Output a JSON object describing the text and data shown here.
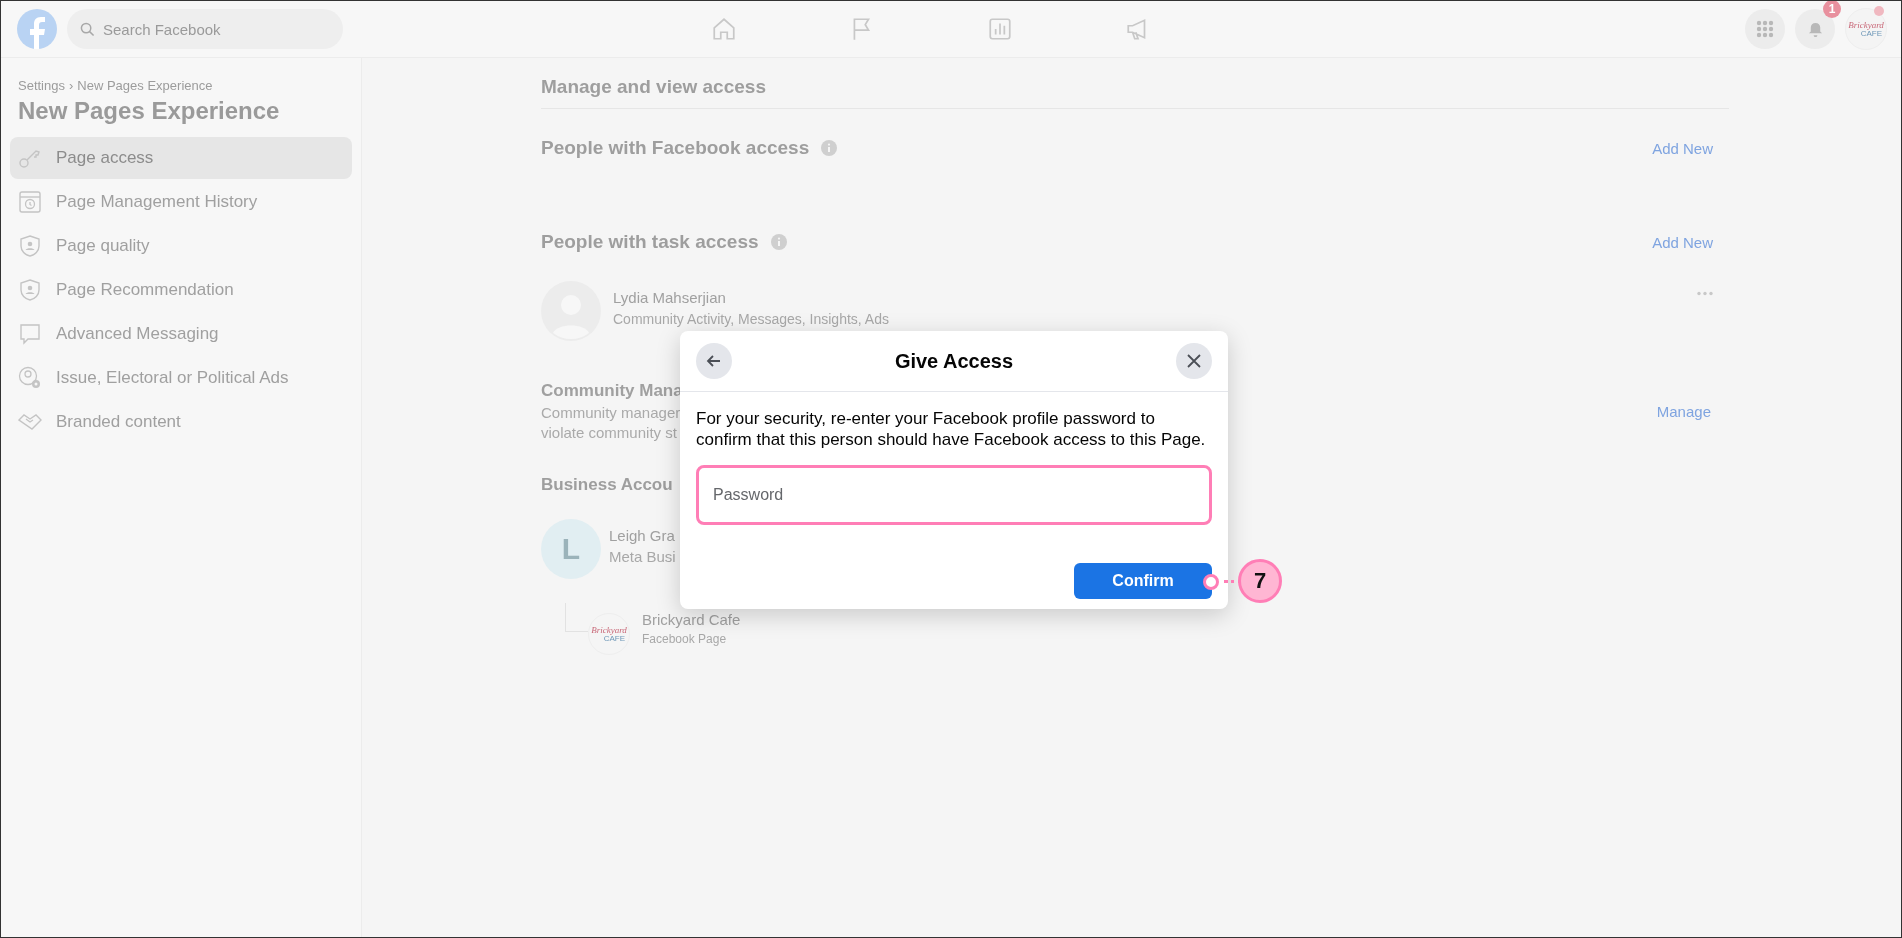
{
  "topbar": {
    "search": {
      "placeholder": "Search Facebook"
    },
    "notification_count": "1",
    "avatar_logo": [
      "Brickyard",
      "CAFE"
    ]
  },
  "sidebar": {
    "breadcrumb": [
      "Settings",
      "New Pages Experience"
    ],
    "breadcrumb_separator": "›",
    "title": "New Pages Experience",
    "items": [
      {
        "label": "Page access",
        "kind": "key",
        "selected": true
      },
      {
        "label": "Page Management History",
        "kind": "history",
        "selected": false
      },
      {
        "label": "Page quality",
        "kind": "shield",
        "selected": false
      },
      {
        "label": "Page Recommendation",
        "kind": "shield",
        "selected": false
      },
      {
        "label": "Advanced Messaging",
        "kind": "chat",
        "selected": false
      },
      {
        "label": "Issue, Electoral or Political Ads",
        "kind": "person-gear",
        "selected": false
      },
      {
        "label": "Branded content",
        "kind": "handshake",
        "selected": false
      }
    ]
  },
  "main": {
    "heading": "Manage and view access",
    "facebook_access": {
      "title": "People with Facebook access",
      "action": "Add New"
    },
    "task_access": {
      "title": "People with task access",
      "action": "Add New",
      "people": [
        {
          "name": "Lydia Mahserjian",
          "roles": "Community Activity, Messages, Insights, Ads"
        }
      ]
    },
    "community_manager": {
      "title": "Community Mana",
      "description_lines": [
        "Community manager",
        "violate community st"
      ],
      "action": "Manage"
    },
    "business_accounts": {
      "title": "Business Accou",
      "account": {
        "initial": "L",
        "name": "Leigh Gra",
        "subtitle": "Meta Busi"
      },
      "page": {
        "name": "Brickyard Cafe",
        "subtitle": "Facebook Page",
        "logo": [
          "Brickyard",
          "CAFE"
        ]
      }
    }
  },
  "dialog": {
    "title": "Give Access",
    "message": "For your security, re-enter your Facebook profile password to confirm that this person should have Facebook access to this Page.",
    "password": {
      "placeholder": "Password"
    },
    "confirm": "Confirm"
  },
  "callout": {
    "number": "7"
  }
}
